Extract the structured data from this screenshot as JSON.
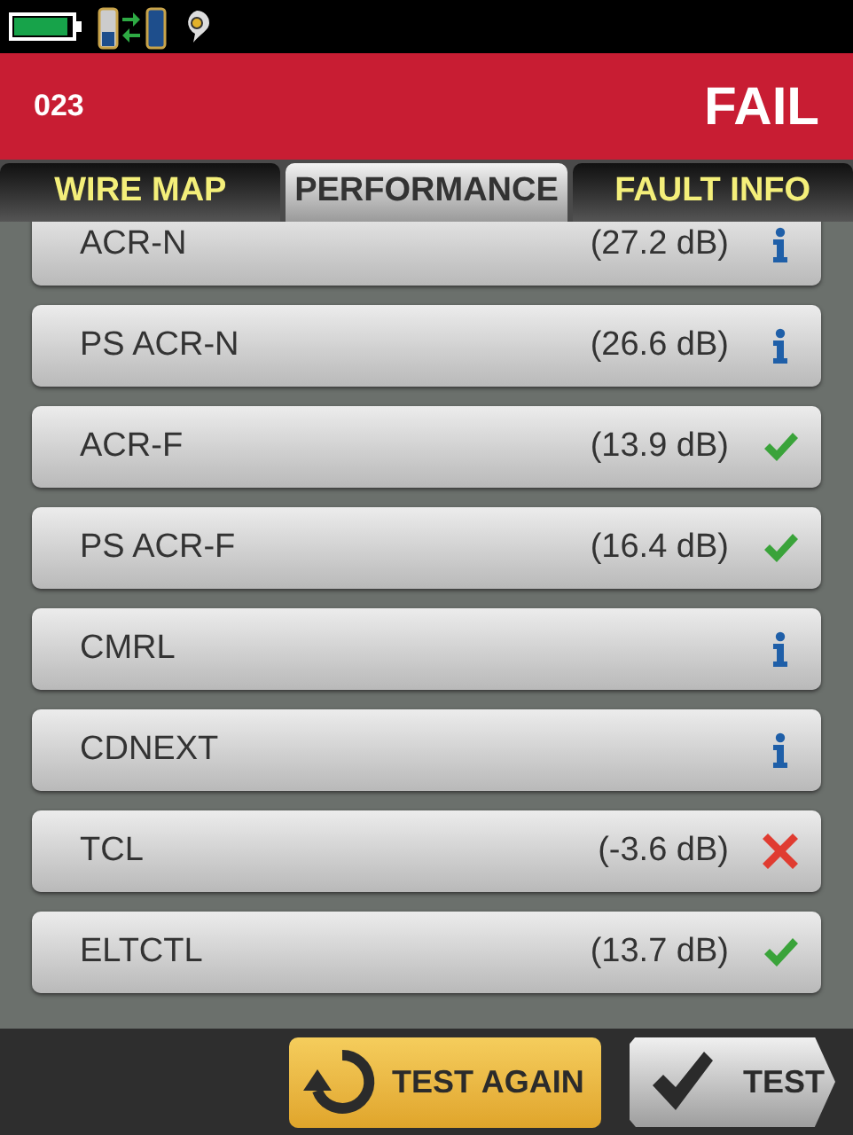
{
  "header": {
    "id": "023",
    "result": "FAIL"
  },
  "tabs": [
    {
      "label": "WIRE MAP",
      "selected": false
    },
    {
      "label": "PERFORMANCE",
      "selected": true
    },
    {
      "label": "FAULT INFO",
      "selected": false
    }
  ],
  "rows": [
    {
      "name": "ACR-N",
      "reading": "(27.2 dB)",
      "kind": "info"
    },
    {
      "name": "PS ACR-N",
      "reading": "(26.6 dB)",
      "kind": "info"
    },
    {
      "name": "ACR-F",
      "reading": "(13.9 dB)",
      "kind": "pass"
    },
    {
      "name": "PS ACR-F",
      "reading": "(16.4 dB)",
      "kind": "pass"
    },
    {
      "name": "CMRL",
      "kind": "info"
    },
    {
      "name": "CDNEXT",
      "kind": "info"
    },
    {
      "name": "TCL",
      "reading": "(-3.6 dB)",
      "kind": "fail"
    },
    {
      "name": "ELTCTL",
      "reading": "(13.7 dB)",
      "kind": "pass"
    }
  ],
  "buttons": [
    {
      "label": "TEST AGAIN",
      "kind": "retest"
    },
    {
      "label": "TEST",
      "kind": "next"
    }
  ]
}
